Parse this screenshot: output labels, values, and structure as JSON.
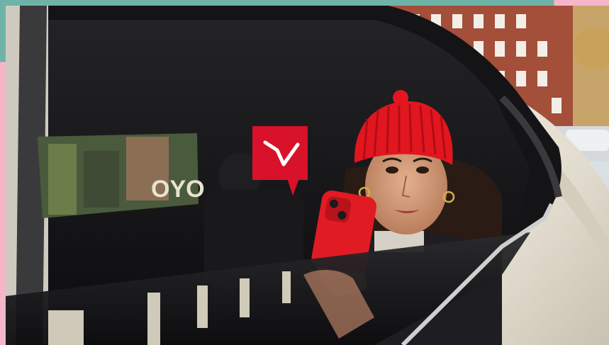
{
  "colors": {
    "frame_teal": "#6fb3a8",
    "frame_pink": "#f4b6c8",
    "brand_red": "#d8122a",
    "beanie_red": "#e2161f",
    "phone_red": "#e01b24",
    "car_body": "#e9e4d8",
    "car_interior": "#1b1b1d",
    "sky": "#dfe9ee",
    "brick": "#a44f3a"
  },
  "image": {
    "subject": "woman-in-red-beanie-looking-out-car-window-holding-red-phone",
    "logo_icon": "chat-bubble-check-logo-icon"
  },
  "background_sign_text": "OYO"
}
